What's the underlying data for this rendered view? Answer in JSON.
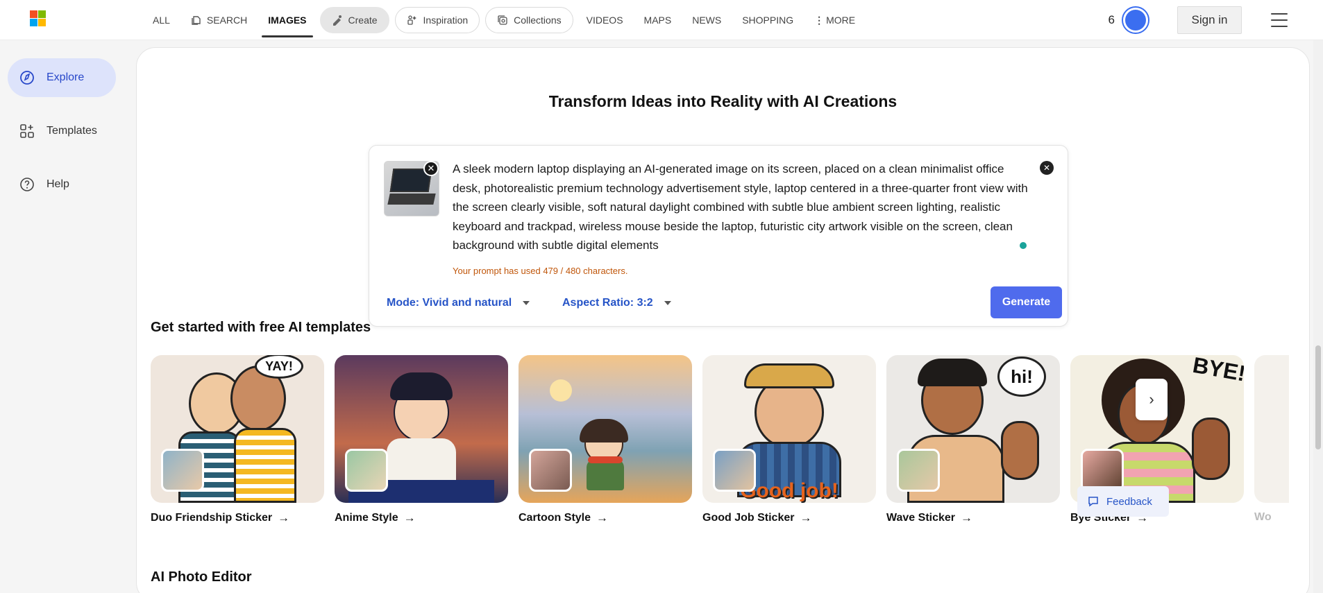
{
  "brand": {
    "logo_colors": [
      "#f25022",
      "#7fba00",
      "#00a4ef",
      "#ffb900"
    ],
    "accent": "#4f6bed",
    "link_blue": "#2654c7",
    "warning_orange": "#c0560a"
  },
  "nav": {
    "all": "ALL",
    "search": "SEARCH",
    "images": "IMAGES",
    "create": "Create",
    "inspiration": "Inspiration",
    "collections": "Collections",
    "videos": "VIDEOS",
    "maps": "MAPS",
    "news": "NEWS",
    "shopping": "SHOPPING",
    "more": "MORE",
    "more_icon": "vertical-ellipsis-icon"
  },
  "account": {
    "reward_count": "6",
    "reward_icon": "rewards-medal-icon",
    "sign_in": "Sign in",
    "menu_icon": "hamburger-menu-icon"
  },
  "sidebar": {
    "items": [
      {
        "label": "Explore",
        "icon": "compass-icon",
        "active": true
      },
      {
        "label": "Templates",
        "icon": "templates-grid-icon",
        "active": false
      },
      {
        "label": "Help",
        "icon": "question-circle-icon",
        "active": false
      }
    ]
  },
  "main": {
    "headline": "Transform Ideas into Reality with AI Creations",
    "prompt": {
      "text": "A sleek modern laptop displaying an AI-generated image on its screen, placed on a clean minimalist office desk, photorealistic premium technology advertisement style, laptop centered in a three-quarter front view with the screen clearly visible, soft natural daylight combined with subtle blue ambient screen lighting, realistic keyboard and trackpad, wireless mouse beside the laptop, futuristic city artwork visible on the screen, clean background with subtle digital elements",
      "char_count_text": "Your prompt has used 479 / 480 characters.",
      "chars_used": 479,
      "chars_max": 480,
      "mode_label": "Mode: Vivid and natural",
      "ratio_label": "Aspect Ratio: 3:2",
      "generate_label": "Generate",
      "thumb_close": "✕",
      "clear": "✕"
    },
    "templates_title": "Get started with free AI templates",
    "templates": [
      {
        "label": "Duo Friendship Sticker",
        "bubble": "YAY!"
      },
      {
        "label": "Anime Style",
        "bubble": ""
      },
      {
        "label": "Cartoon Style",
        "bubble": ""
      },
      {
        "label": "Good Job Sticker",
        "bubble": "Good job!"
      },
      {
        "label": "Wave Sticker",
        "bubble": "hi!"
      },
      {
        "label": "Bye Sticker",
        "bubble": "BYE!"
      },
      {
        "label": "Wo",
        "bubble": ""
      }
    ],
    "arrow": "→",
    "next": "›",
    "photo_editor_title": "AI Photo Editor",
    "feedback": "Feedback"
  }
}
